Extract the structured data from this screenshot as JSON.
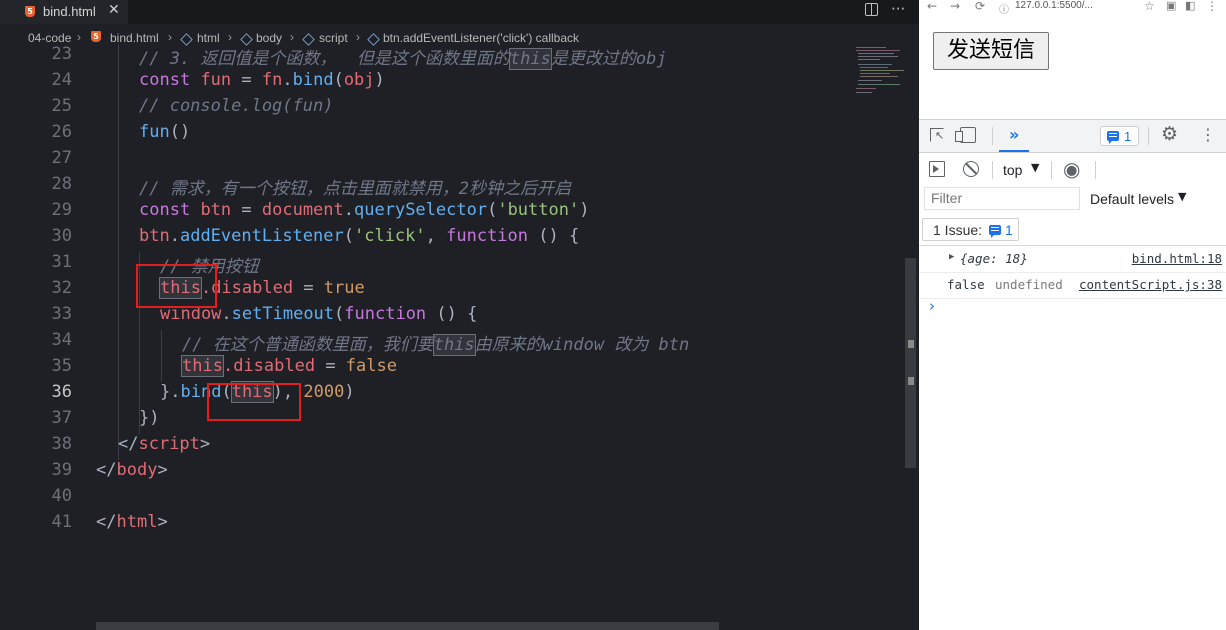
{
  "editor": {
    "tab": {
      "label": "bind.html",
      "close": "✕"
    },
    "actions": {
      "split": "split-editor",
      "more": "···"
    },
    "breadcrumb": [
      "04-code",
      "bind.html",
      "html",
      "body",
      "script",
      "btn.addEventListener('click') callback"
    ],
    "breadcrumb_sep": "›",
    "line_numbers": [
      "23",
      "24",
      "25",
      "26",
      "27",
      "28",
      "29",
      "30",
      "31",
      "32",
      "33",
      "34",
      "35",
      "36",
      "37",
      "38",
      "39",
      "40",
      "41"
    ],
    "active_line": "36",
    "code": {
      "l23": {
        "comment_a": "// 3. 返回值是个函数，  但是这个函数里面的",
        "this": "this",
        "comment_b": "是更改过的obj"
      },
      "l24": {
        "kw": "const",
        "name": "fun",
        "eq": " = ",
        "obj": "fn",
        "dot": ".",
        "method": "bind",
        "open": "(",
        "arg": "obj",
        "close": ")"
      },
      "l25": {
        "comment": "// console.log(fun)"
      },
      "l26": {
        "call": "fun",
        "parens": "()"
      },
      "l28": {
        "comment": "// 需求，有一个按钮，点击里面就禁用，2秒钟之后开启"
      },
      "l29": {
        "kw": "const",
        "name": "btn",
        "eq": " = ",
        "obj": "document",
        "dot": ".",
        "method": "querySelector",
        "open": "(",
        "str": "'button'",
        "close": ")"
      },
      "l30": {
        "obj": "btn",
        "dot": ".",
        "method": "addEventListener",
        "open": "(",
        "str": "'click'",
        "comma": ", ",
        "kw": "function",
        "rest": " () {"
      },
      "l31": {
        "comment": "// 禁用按钮"
      },
      "l32": {
        "this": "this",
        "prop": ".disabled",
        "eq": " = ",
        "val": "true"
      },
      "l33": {
        "obj": "window",
        "dot": ".",
        "method": "setTimeout",
        "open": "(",
        "kw": "function",
        "rest": " () {"
      },
      "l34": {
        "comment_a": "// 在这个普通函数里面，我们要",
        "this": "this",
        "comment_b": "由原来的window 改为 btn"
      },
      "l35": {
        "this": "this",
        "prop": ".disabled",
        "eq": " = ",
        "val": "false"
      },
      "l36": {
        "close": "}",
        "dot": ".",
        "method": "bind",
        "open": "(",
        "this": "this",
        "close2": "), ",
        "num": "2000",
        "end": ")"
      },
      "l37": {
        "text": "})"
      },
      "l38": {
        "open": "</",
        "tag": "script",
        "close": ">"
      },
      "l39": {
        "open": "</",
        "tag": "body",
        "close": ">"
      },
      "l41": {
        "open": "</",
        "tag": "html",
        "close": ">"
      }
    }
  },
  "browser": {
    "url": "127.0.0.1:5500/...",
    "nav": {
      "back": "←",
      "forward": "→",
      "reload": "⟳",
      "star": "☆"
    },
    "page_button": "发送短信",
    "devtools": {
      "more_panels": "»",
      "issues_count": "1",
      "gear": "⚙",
      "kebab": "⋮",
      "context": "top",
      "caret": "▼",
      "eye": "👁",
      "filter_placeholder": "Filter",
      "levels": "Default levels",
      "issues_label": "1 Issue:",
      "issues_pill_count": "1",
      "logs": [
        {
          "arrow": "▶",
          "text": "{age: 18}",
          "source": "bind.html:18"
        },
        {
          "a": "false",
          "b": "undefined",
          "source": "contentScript.js:38"
        }
      ],
      "prompt": "›"
    }
  }
}
